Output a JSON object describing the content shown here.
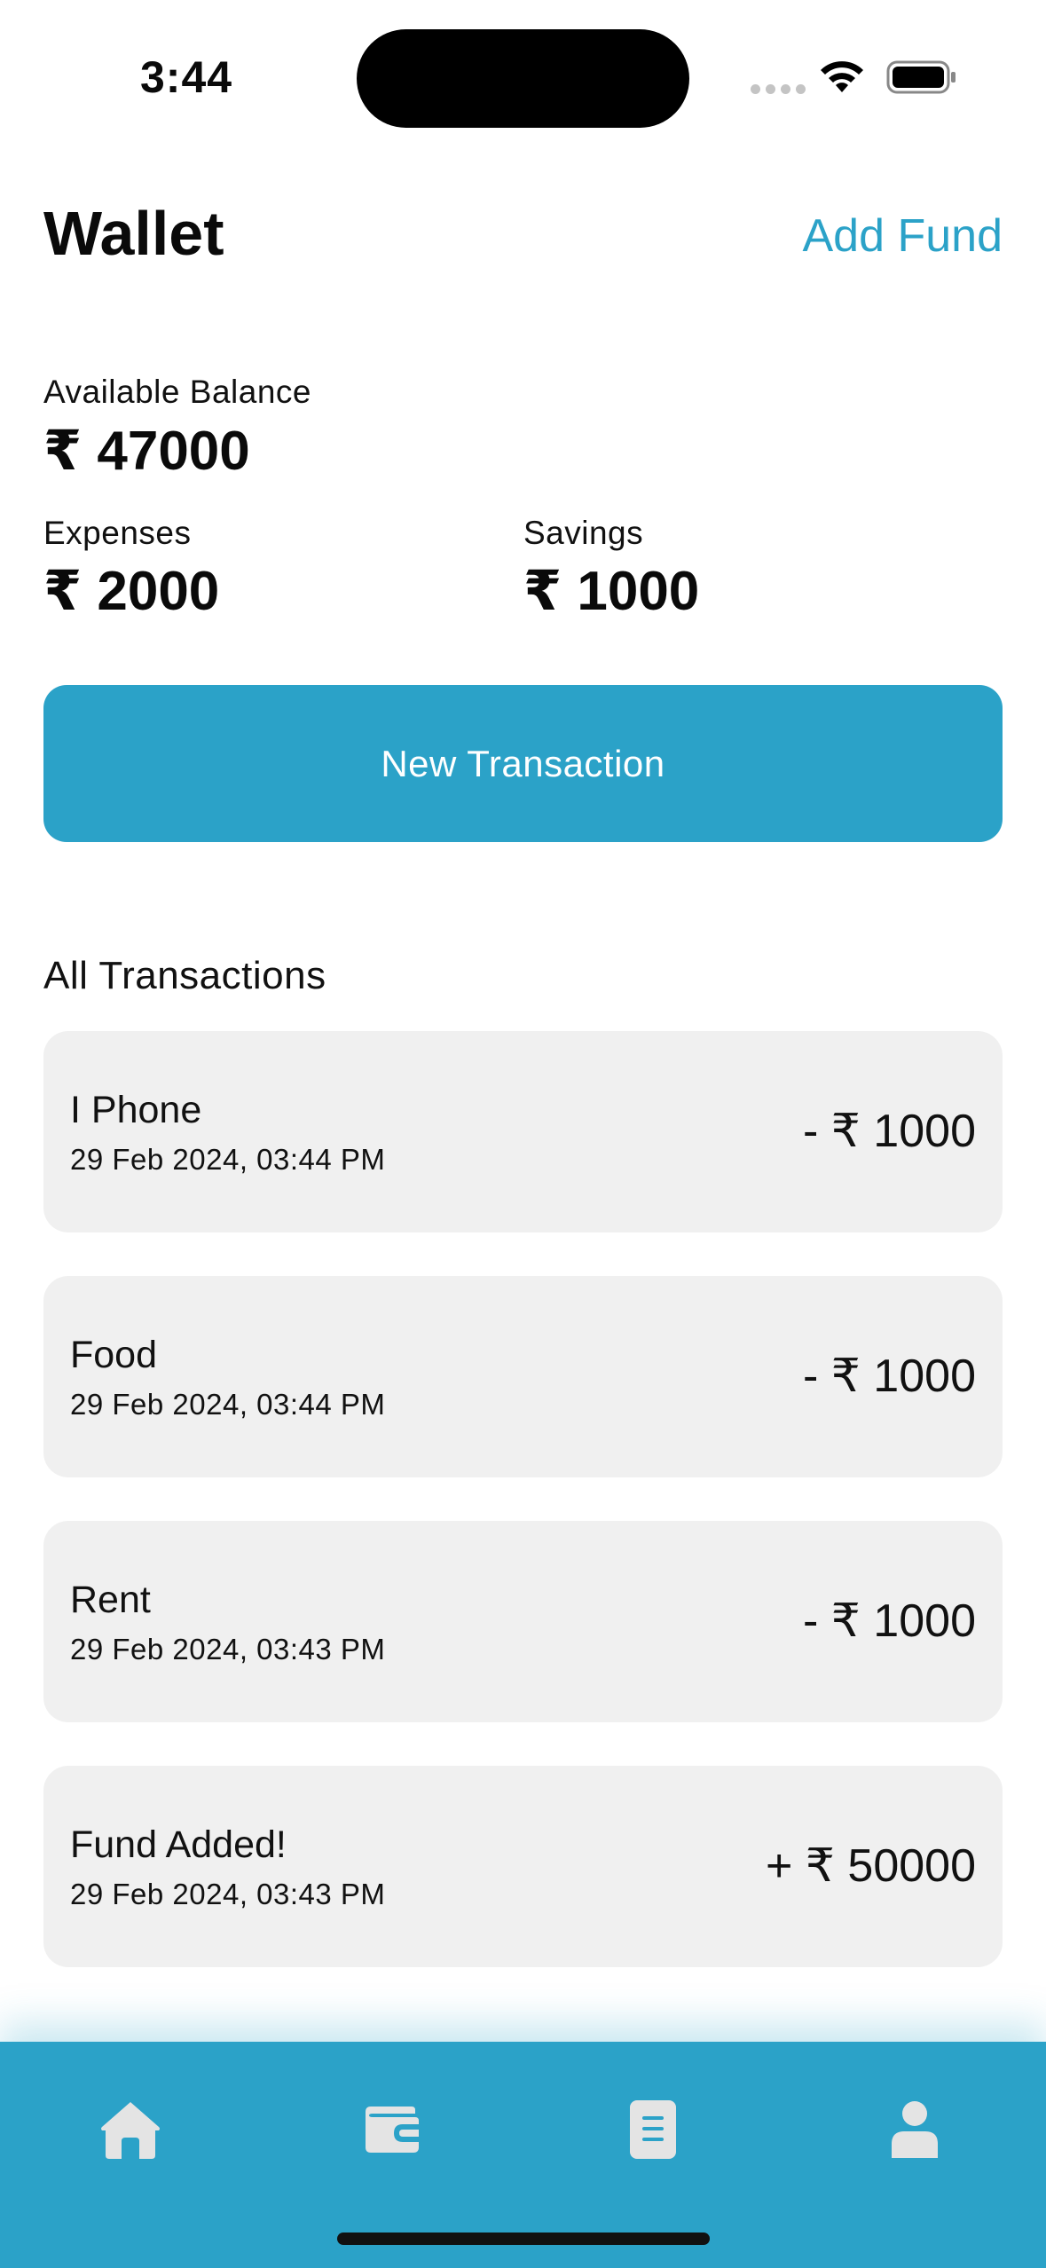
{
  "status_bar": {
    "time": "3:44",
    "icons": [
      "cellular-dots-icon",
      "wifi-icon",
      "battery-icon"
    ]
  },
  "header": {
    "title": "Wallet",
    "add_fund_label": "Add Fund"
  },
  "balance": {
    "available_label": "Available Balance",
    "available_amount": "₹ 47000",
    "expenses_label": "Expenses",
    "expenses_amount": "₹ 2000",
    "savings_label": "Savings",
    "savings_amount": "₹ 1000"
  },
  "new_transaction_label": "New Transaction",
  "transactions_title": "All Transactions",
  "transactions": [
    {
      "name": "I Phone",
      "date": "29 Feb 2024, 03:44 PM",
      "amount": "- ₹ 1000"
    },
    {
      "name": "Food",
      "date": "29 Feb 2024, 03:44 PM",
      "amount": "- ₹ 1000"
    },
    {
      "name": "Rent",
      "date": "29 Feb 2024, 03:43 PM",
      "amount": "- ₹ 1000"
    },
    {
      "name": "Fund Added!",
      "date": "29 Feb 2024, 03:43 PM",
      "amount": "+ ₹ 50000"
    }
  ],
  "bottom_nav": {
    "items": [
      "home-icon",
      "wallet-icon",
      "document-icon",
      "profile-icon"
    ]
  },
  "colors": {
    "accent": "#2ba2c8",
    "card_bg": "#f0f0f0",
    "nav_icon": "#e4e4e4"
  }
}
